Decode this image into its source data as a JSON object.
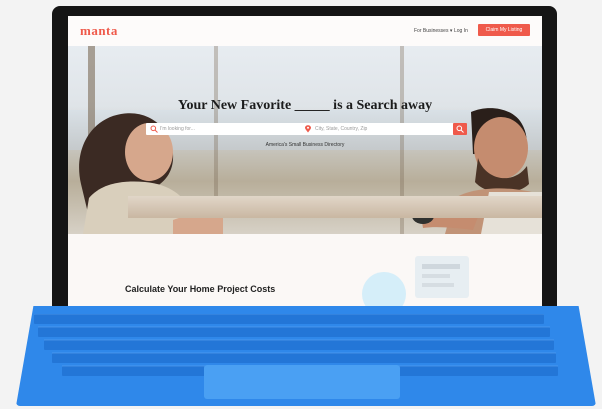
{
  "brand": {
    "name": "manta",
    "accent_color": "#ef5a4b"
  },
  "nav": {
    "for_businesses": "For Businesses ▾",
    "login": "Log In",
    "claim_button": "Claim My Listing"
  },
  "hero": {
    "headline": "Your New Favorite _____ is a Search away",
    "search_placeholder": "I'm looking for...",
    "location_placeholder": "City, State, Country, Zip",
    "subline": "America's Small Business Directory",
    "search_icon": "search-icon",
    "location_icon": "location-pin-icon"
  },
  "sections": {
    "calculator_title": "Calculate Your Home Project Costs"
  },
  "device": {
    "keyboard_color": "#2f88ea"
  }
}
